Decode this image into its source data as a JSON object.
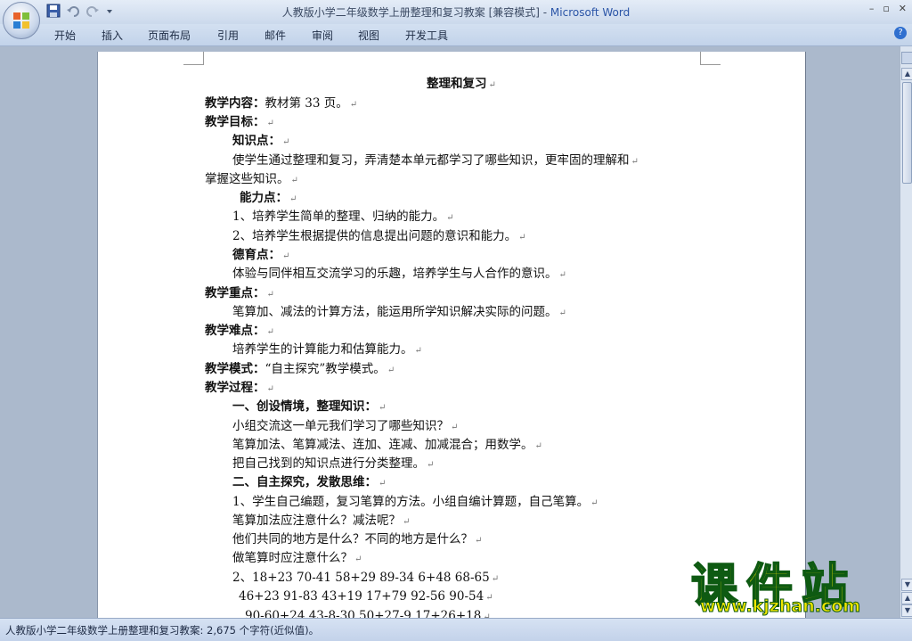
{
  "window": {
    "title_doc": "人教版小学二年级数学上册整理和复习教案 [兼容模式] - ",
    "title_app": "Microsoft Word",
    "controls": [
      "–",
      "▫",
      "✕"
    ]
  },
  "ribbon": {
    "tabs": [
      "开始",
      "插入",
      "页面布局",
      "引用",
      "邮件",
      "审阅",
      "视图",
      "开发工具"
    ],
    "help": "?"
  },
  "document": {
    "lines": [
      {
        "text": "整理和复习",
        "bold": true
      },
      {
        "label": "教学内容：",
        "text": "教材第 33 页。"
      },
      {
        "label": "教学目标：",
        "text": ""
      },
      {
        "label": "知识点：",
        "text": ""
      },
      {
        "text": "使学生通过整理和复习，弄清楚本单元都学习了哪些知识，更牢固的理解和"
      },
      {
        "text": "掌握这些知识。"
      },
      {
        "label": "能力点：",
        "text": ""
      },
      {
        "text": "1、培养学生简单的整理、归纳的能力。"
      },
      {
        "text": "2、培养学生根据提供的信息提出问题的意识和能力。"
      },
      {
        "label": "德育点：",
        "text": ""
      },
      {
        "text": "体验与同伴相互交流学习的乐趣，培养学生与人合作的意识。"
      },
      {
        "label": "教学重点：",
        "text": ""
      },
      {
        "text": "笔算加、减法的计算方法，能运用所学知识解决实际的问题。"
      },
      {
        "label": "教学难点：",
        "text": ""
      },
      {
        "text": "培养学生的计算能力和估算能力。"
      },
      {
        "label": "教学模式：",
        "text": "“自主探究”教学模式。"
      },
      {
        "label": "教学过程：",
        "text": ""
      },
      {
        "text": "一、创设情境，整理知识：",
        "bold": true
      },
      {
        "text": "小组交流这一单元我们学习了哪些知识？"
      },
      {
        "text": "笔算加法、笔算减法、连加、连减、加减混合；用数学。"
      },
      {
        "text": "把自己找到的知识点进行分类整理。"
      },
      {
        "text": "二、自主探究，发散思维：",
        "bold": true
      },
      {
        "text": "1、学生自己编题，复习笔算的方法。小组自编计算题，自己笔算。"
      },
      {
        "text": "笔算加法应注意什么？减法呢？"
      },
      {
        "text": "他们共同的地方是什么？不同的地方是什么？"
      },
      {
        "text": "做笔算时应注意什么？"
      },
      {
        "text": "2、18+23    70-41       58+29       89-34       6+48       68-65"
      },
      {
        "text": "46+23    91-83       43+19       17+79       92-56     90-54"
      },
      {
        "text": "90-60+24       43-8-30       50+27-9       17+26+18"
      }
    ]
  },
  "status": {
    "text": "人教版小学二年级数学上册整理和复习教案: 2,675 个字符(近似值)。"
  },
  "watermark": {
    "main": "课件站",
    "url": "www.kjzhan.com"
  }
}
